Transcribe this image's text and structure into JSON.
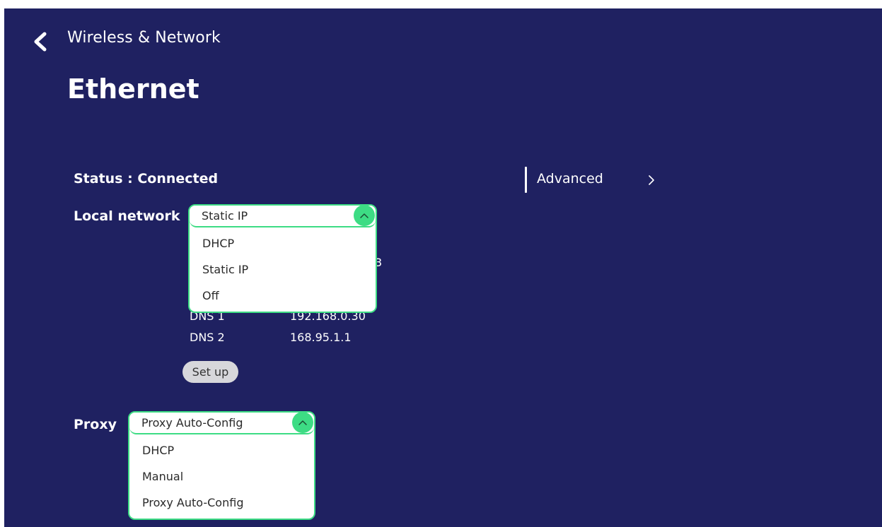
{
  "header": {
    "back_label": "Wireless & Network",
    "title": "Ethernet"
  },
  "status": {
    "text": "Status : Connected"
  },
  "advanced": {
    "label": "Advanced"
  },
  "local_network": {
    "label": "Local network",
    "selected": "Static IP",
    "options": [
      "DHCP",
      "Static IP",
      "Off"
    ],
    "hidden_value_tail": "3",
    "info": [
      {
        "key": "DNS 1",
        "value": "192.168.0.30"
      },
      {
        "key": "DNS 2",
        "value": "168.95.1.1"
      }
    ],
    "setup_label": "Set up"
  },
  "proxy": {
    "label": "Proxy",
    "selected": "Proxy Auto-Config",
    "options": [
      "DHCP",
      "Manual",
      "Proxy Auto-Config"
    ]
  },
  "colors": {
    "background": "#1f2161",
    "accent": "#3ddc84",
    "text": "#ffffff",
    "button_bg": "#d7d7db"
  },
  "icons": {
    "back": "chevron-left-icon",
    "advanced": "chevron-right-icon",
    "dropdown_toggle": "chevron-up-icon"
  }
}
